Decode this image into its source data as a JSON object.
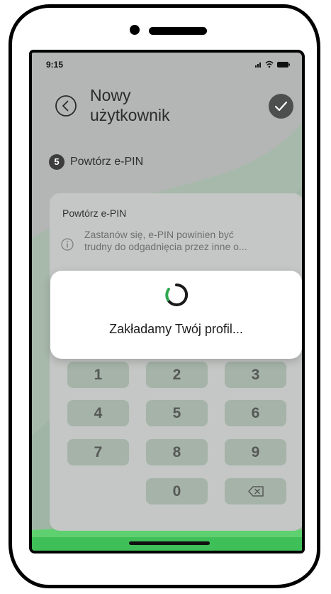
{
  "status_bar": {
    "time": "9:15"
  },
  "header": {
    "title_line1": "Nowy",
    "title_line2": "użytkownik"
  },
  "step": {
    "number": "5",
    "label": "Powtórz e-PIN"
  },
  "pin_card": {
    "label": "Powtórz e-PIN",
    "hint_line1": "Zastanów się, e-PIN powinien być",
    "hint_line2": "trudny do odgadnięcia przez inne o..."
  },
  "keypad": {
    "keys": [
      "1",
      "2",
      "3",
      "4",
      "5",
      "6",
      "7",
      "8",
      "9",
      "0"
    ]
  },
  "modal": {
    "message": "Zakładamy Twój profil..."
  },
  "colors": {
    "accent_green": "#2fa84f",
    "screen_overlay": "#b3b6b4",
    "key_fill": "#a5b3a9"
  },
  "icons": {
    "back": "chevron-left-circle-icon",
    "confirm": "check-circle-icon",
    "info": "info-icon",
    "backspace": "backspace-icon",
    "loading": "spinner-icon"
  }
}
